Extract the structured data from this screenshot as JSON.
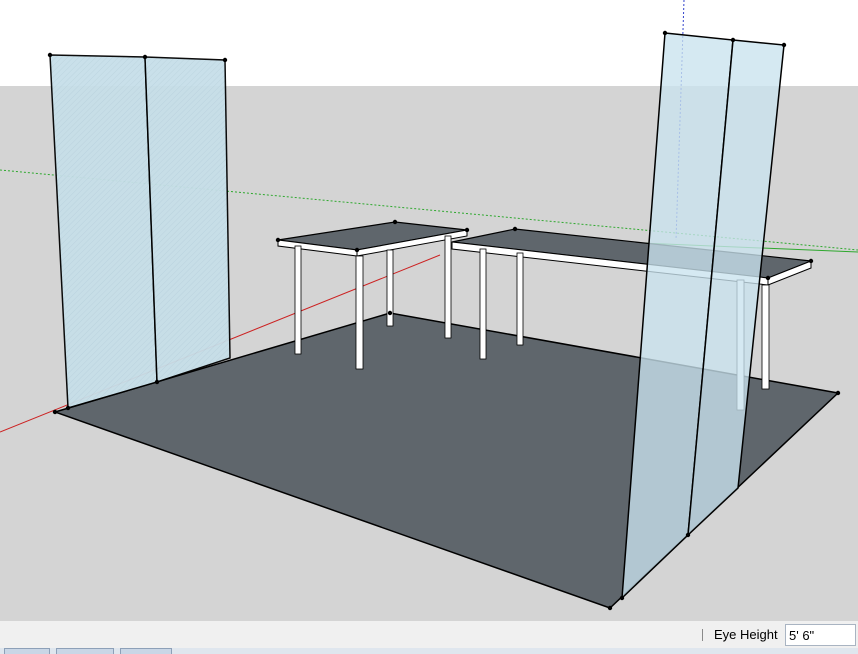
{
  "scene": {
    "sky_color": "#ffffff",
    "ground_color": "#d4d4d4",
    "floor_color": "#5f666c",
    "panel_fill": "#cde4ee",
    "table_top_color": "#5f666c",
    "table_leg_color": "#ffffff",
    "edge_color": "#000000",
    "axes": {
      "red_axis_color": "#cc2222",
      "green_axis_color": "#2ea82e",
      "blue_axis_color": "#3344cc"
    },
    "objects": [
      "floor-slab",
      "left-glass-panel",
      "right-glass-panel",
      "small-table",
      "long-table"
    ]
  },
  "status_bar": {
    "measurements_label": "Eye Height",
    "measurements_value": "5' 6\""
  }
}
